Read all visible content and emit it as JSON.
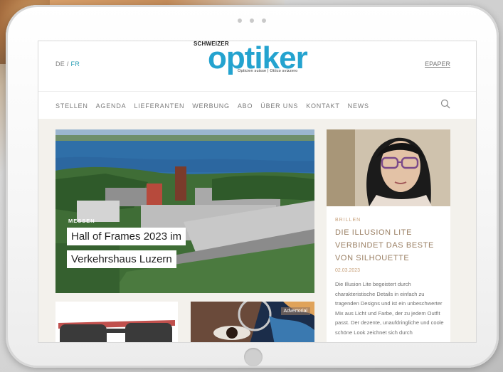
{
  "header": {
    "lang_de": "DE",
    "lang_sep": " / ",
    "lang_fr": "FR",
    "logo_top": "SCHWEIZER",
    "logo_word": "optiker",
    "logo_tag": "Opticien suisse | Ottico svizzero",
    "epaper": "EPAPER"
  },
  "nav": {
    "items": [
      "STELLEN",
      "AGENDA",
      "LIEFERANTEN",
      "WERBUNG",
      "ABO",
      "ÜBER UNS",
      "KONTAKT",
      "NEWS"
    ]
  },
  "hero": {
    "kicker": "MESSEN",
    "title_line1": "Hall of Frames 2023 im",
    "title_line2": "Verkehrshaus Luzern"
  },
  "card": {
    "category": "BRILLEN",
    "title": "DIE ILLUSION LITE VERBINDET DAS BESTE VON SILHOUETTE",
    "date": "02.03.2023",
    "text": "Die Illusion Lite begeistert durch charakteristische Details in einfach zu tragenden Designs und ist ein unbeschwerter Mix aus Licht und Farbe, der zu jedem Outfit passt. Der dezente, unaufdringliche und coole schöne Look zeichnet sich durch"
  },
  "tiles": {
    "advertorial": "Advertorial"
  },
  "colors": {
    "brand": "#24a3cf",
    "accent": "#c9a37e"
  }
}
